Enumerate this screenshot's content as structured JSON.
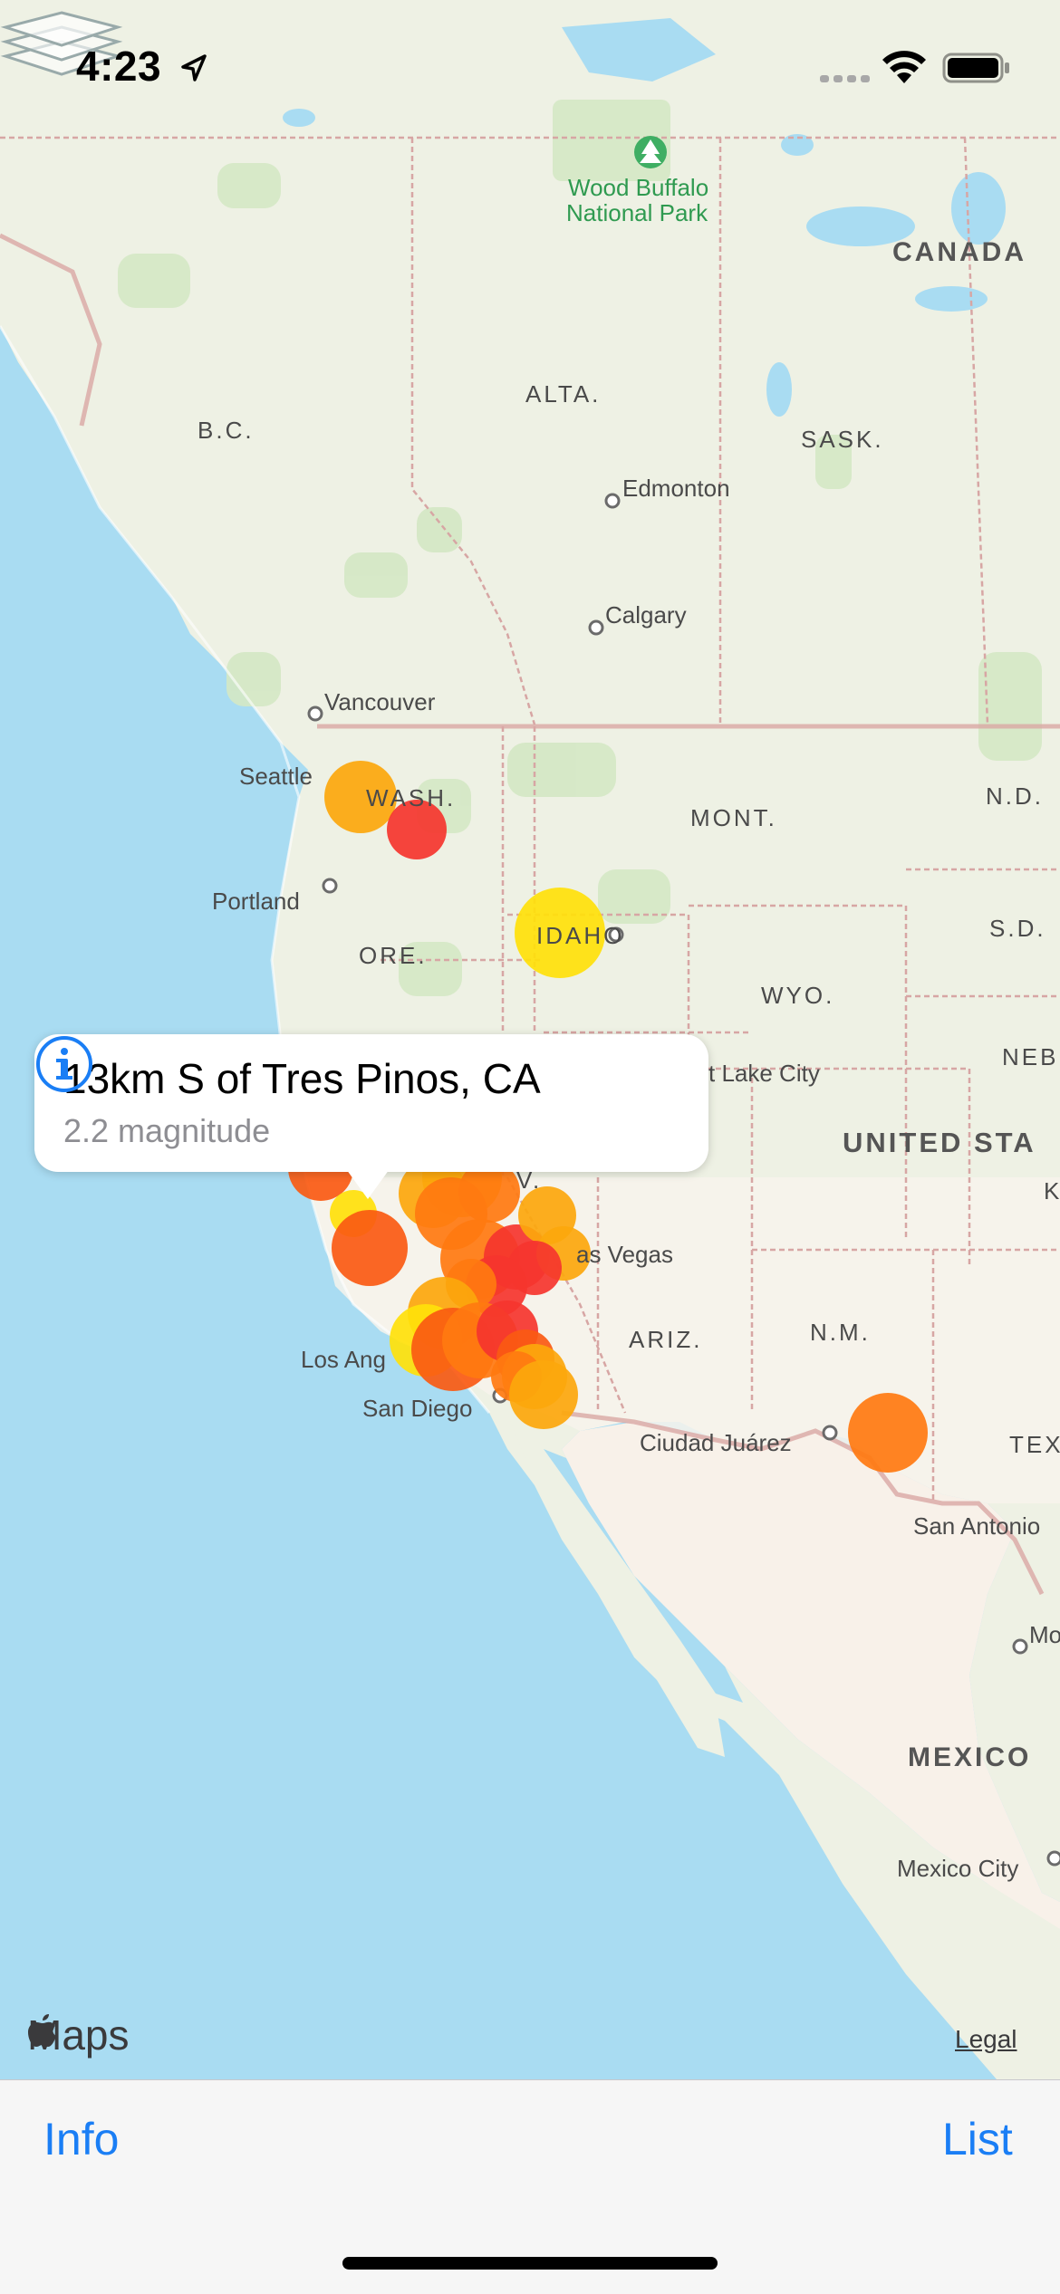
{
  "status_bar": {
    "time": "4:23"
  },
  "map": {
    "labels": {
      "wood_buffalo": "Wood Buffalo",
      "national_park": "National Park",
      "canada": "CANADA",
      "alta": "ALTA.",
      "bc": "B.C.",
      "sask": "SASK.",
      "edmonton": "Edmonton",
      "calgary": "Calgary",
      "vancouver": "Vancouver",
      "seattle": "Seattle",
      "wash": "WASH.",
      "mont": "MONT.",
      "nd": "N.D.",
      "portland": "Portland",
      "ore": "ORE.",
      "idaho": "IDAHO",
      "sd": "S.D.",
      "wyo": "WYO.",
      "neb": "NEB",
      "salt_lake_city": "t Lake City",
      "united_states": "UNITED STA",
      "k": "K",
      "nev": "V.",
      "las_vegas": "as Vegas",
      "ariz": "ARIZ.",
      "nm": "N.M.",
      "los_angeles": "Los Ang",
      "san_diego": "San Diego",
      "ciudad_juarez": "Ciudad Juárez",
      "tex": "TEX",
      "san_antonio": "San Antonio",
      "mo": "Mo",
      "mexico": "MEXICO",
      "mexico_city": "Mexico City"
    },
    "attribution": {
      "maps_label": "Maps",
      "legal": "Legal"
    },
    "earthquakes_colors": {
      "red": "#f5352e",
      "orange_red": "#fa5a12",
      "orange": "#ff7a10",
      "amber": "#fca70c",
      "yellow": "#ffe10a"
    }
  },
  "callout": {
    "title": "13km S of Tres Pinos, CA",
    "subtitle": "2.2 magnitude"
  },
  "toolbar": {
    "info_label": "Info",
    "list_label": "List"
  },
  "colors": {
    "accent": "#1a7ef5",
    "water": "#a9dcf2",
    "land": "#eef1e4"
  }
}
